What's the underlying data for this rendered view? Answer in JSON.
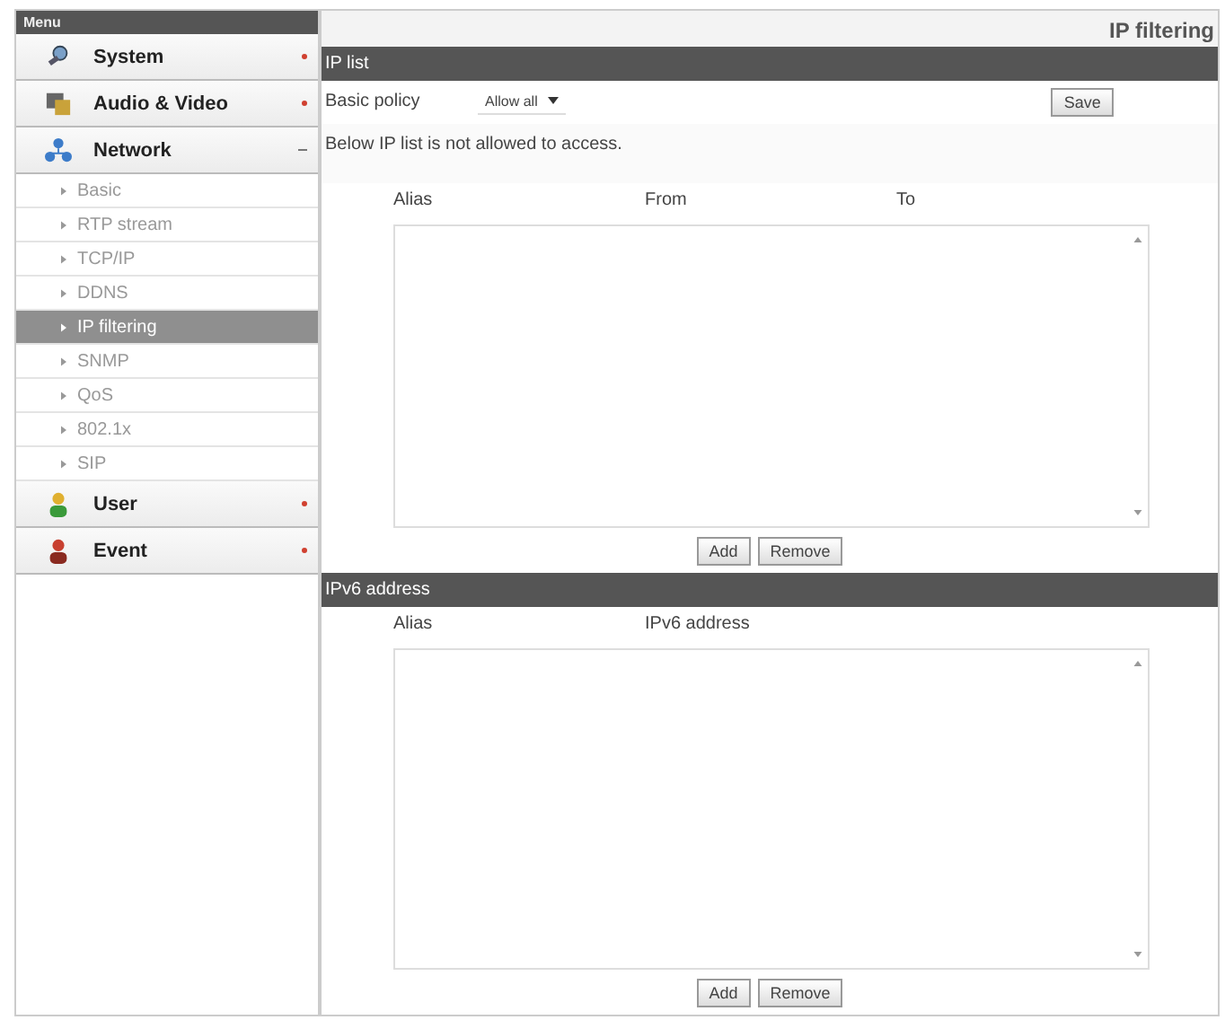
{
  "sidebar": {
    "title": "Menu",
    "items": [
      {
        "label": "System",
        "kind": "system",
        "expanded": false
      },
      {
        "label": "Audio & Video",
        "kind": "video",
        "expanded": false
      },
      {
        "label": "Network",
        "kind": "network",
        "expanded": true,
        "children": [
          {
            "label": "Basic",
            "selected": false
          },
          {
            "label": "RTP stream",
            "selected": false
          },
          {
            "label": "TCP/IP",
            "selected": false
          },
          {
            "label": "DDNS",
            "selected": false
          },
          {
            "label": "IP filtering",
            "selected": true
          },
          {
            "label": "SNMP",
            "selected": false
          },
          {
            "label": "QoS",
            "selected": false
          },
          {
            "label": "802.1x",
            "selected": false
          },
          {
            "label": "SIP",
            "selected": false
          }
        ]
      },
      {
        "label": "User",
        "kind": "user",
        "expanded": false
      },
      {
        "label": "Event",
        "kind": "event",
        "expanded": false
      }
    ]
  },
  "page_title": "IP filtering",
  "ip_list": {
    "header": "IP list",
    "policy_label": "Basic policy",
    "policy_value": "Allow all",
    "save": "Save",
    "note": "Below IP list is not allowed to access.",
    "columns": [
      "Alias",
      "From",
      "To"
    ],
    "buttons": [
      "Add",
      "Remove"
    ]
  },
  "ipv6": {
    "header": "IPv6 address",
    "columns": [
      "Alias",
      "IPv6 address"
    ],
    "buttons": [
      "Add",
      "Remove"
    ]
  }
}
